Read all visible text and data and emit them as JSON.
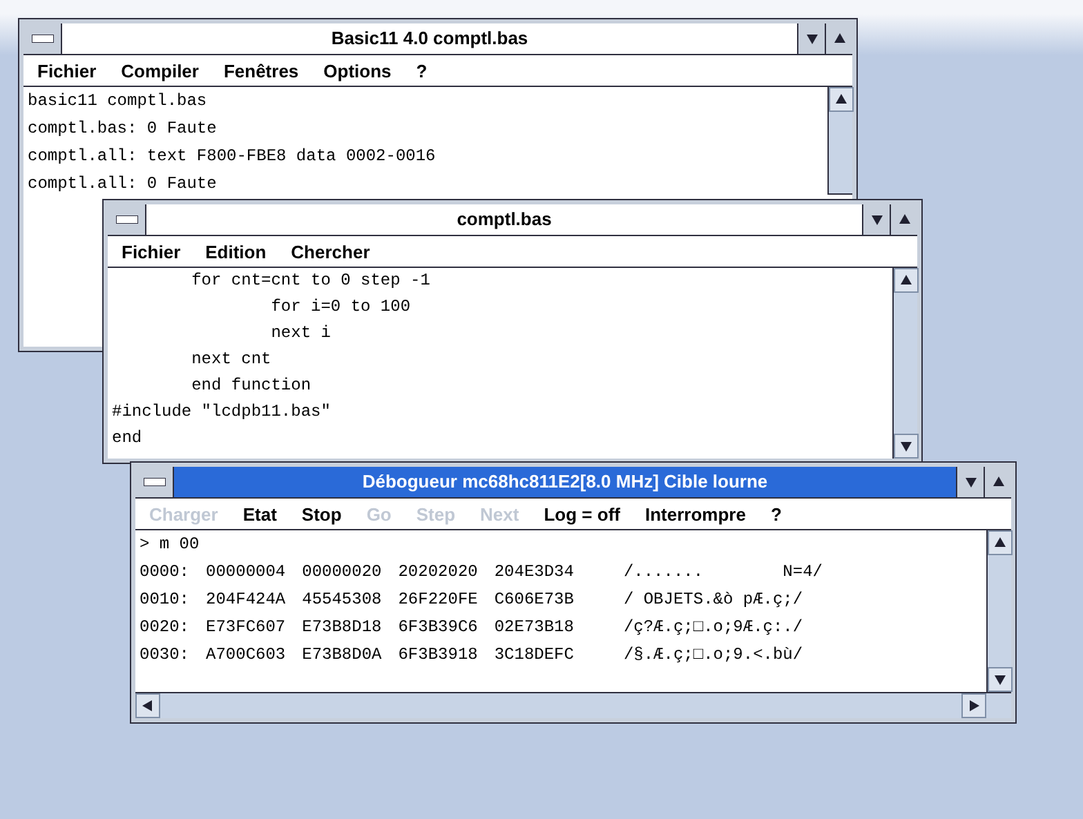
{
  "windows": [
    {
      "title": "Basic11 4.0  comptl.bas",
      "active": false,
      "menu": [
        {
          "label": "Fichier",
          "disabled": false
        },
        {
          "label": "Compiler",
          "disabled": false
        },
        {
          "label": "Fenêtres",
          "disabled": false
        },
        {
          "label": "Options",
          "disabled": false
        },
        {
          "label": "?",
          "disabled": false
        }
      ],
      "lines": [
        "basic11 comptl.bas",
        "comptl.bas: 0 Faute",
        "comptl.all: text F800-FBE8 data 0002-0016",
        "comptl.all: 0 Faute"
      ]
    },
    {
      "title": "comptl.bas",
      "active": false,
      "menu": [
        {
          "label": "Fichier",
          "disabled": false
        },
        {
          "label": "Edition",
          "disabled": false
        },
        {
          "label": "Chercher",
          "disabled": false
        }
      ],
      "lines": [
        "        for cnt=cnt to 0 step -1",
        "                for i=0 to 100",
        "                next i",
        "        next cnt",
        "        end function",
        "#include \"lcdpb11.bas\"",
        "end"
      ]
    },
    {
      "title": "Débogueur mc68hc811E2[8.0 MHz] Cible lourne",
      "active": true,
      "menu": [
        {
          "label": "Charger",
          "disabled": true
        },
        {
          "label": "Etat",
          "disabled": false
        },
        {
          "label": "Stop",
          "disabled": false
        },
        {
          "label": "Go",
          "disabled": true
        },
        {
          "label": "Step",
          "disabled": true
        },
        {
          "label": "Next",
          "disabled": true
        },
        {
          "label": "Log = off",
          "disabled": false
        },
        {
          "label": "Interrompre",
          "disabled": false
        },
        {
          "label": "?",
          "disabled": false
        }
      ],
      "prompt": "> m 00",
      "rows": [
        {
          "address": "0000:",
          "words": [
            "00000004",
            "00000020",
            "20202020",
            "204E3D34"
          ],
          "ascii": "/.......        N=4/"
        },
        {
          "address": "0010:",
          "words": [
            "204F424A",
            "45545308",
            "26F220FE",
            "C606E73B"
          ],
          "ascii": "/ OBJETS.&ò pÆ.ç;/"
        },
        {
          "address": "0020:",
          "words": [
            "E73FC607",
            "E73B8D18",
            "6F3B39C6",
            "02E73B18"
          ],
          "ascii": "/ç?Æ.ç;□.o;9Æ.ç:./"
        },
        {
          "address": "0030:",
          "words": [
            "A700C603",
            "E73B8D0A",
            "6F3B3918",
            "3C18DEFC"
          ],
          "ascii": "/§.Æ.ç;□.o;9.<.bù/"
        }
      ]
    }
  ]
}
